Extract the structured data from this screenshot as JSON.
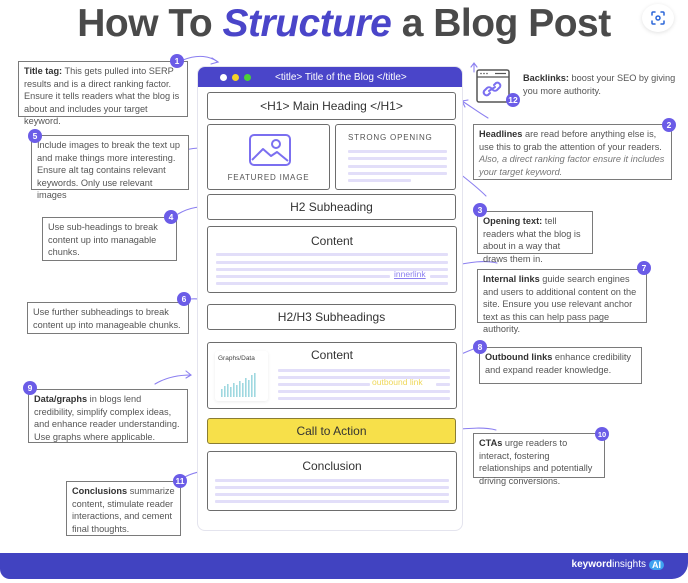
{
  "title": {
    "prefix": "How To ",
    "accent": "Structure",
    "suffix": " a Blog Post",
    "accent_color": "#4a45c9"
  },
  "lens_button": {
    "icon": "lens-scan-icon"
  },
  "browser": {
    "bar_title": "<title> Title of the Blog </title>",
    "bar_color": "#4a45c9",
    "dots": [
      "#ffffff",
      "#f5d327",
      "#4cd137"
    ],
    "h1": "<H1> Main Heading </H1>",
    "featured_image": "FEATURED IMAGE",
    "strong_opening": "STRONG OPENING",
    "h2": "H2 Subheading",
    "content_1": "Content",
    "innerlink": "innerlink",
    "h2h3": "H2/H3 Subheadings",
    "content_2": "Content",
    "graphs_label": "Graphs/Data",
    "outbound_link": "outbound link",
    "cta": "Call to Action",
    "cta_color": "#f7e04a",
    "conclusion": "Conclusion"
  },
  "callouts": {
    "c1": {
      "num": "1",
      "bold": "Title tag:",
      "text": " This gets pulled into SERP results and is a direct ranking factor. Ensure it tells  readers what the blog is about and includes your target keyword."
    },
    "c2": {
      "num": "2",
      "bold": "Headlines",
      "text": " are read before anything else is, use this to grab the attention of your readers.",
      "italic": "Also, a direct ranking factor ensure it includes your target keyword."
    },
    "c3": {
      "num": "3",
      "bold": "Opening text:",
      "text": " tell readers what the blog is about in a way that draws them in."
    },
    "c4": {
      "num": "4",
      "text": "Use sub-headings to break content up into managable chunks."
    },
    "c5": {
      "num": "5",
      "text": "Include images to break the text up and make things more interesting. Ensure alt tag contains relevant keywords.  Only use relevant images"
    },
    "c6": {
      "num": "6",
      "text": "Use further subheadings to break content up into manageable chunks."
    },
    "c7": {
      "num": "7",
      "bold": "Internal links",
      "text": " guide search engines and users to additional content on the site. Ensure you use relevant anchor text as this can help pass page authority."
    },
    "c8": {
      "num": "8",
      "bold": "Outbound links",
      "text": " enhance credibility and expand reader knowledge."
    },
    "c9": {
      "num": "9",
      "bold": "Data/graphs",
      "text": " in blogs lend credibility, simplify complex ideas, and enhance reader understanding. Use graphs where applicable."
    },
    "c10": {
      "num": "10",
      "bold": "CTAs",
      "text": " urge readers to interact, fostering  relationships and potentially driving conversions."
    },
    "c11": {
      "num": "11",
      "bold": "Conclusions",
      "text": " summarize content, stimulate reader interactions, and cement final thoughts."
    },
    "c12": {
      "num": "12",
      "bold": "Backlinks:",
      "text": " boost your SEO by giving you more authority."
    }
  },
  "footer": {
    "brand_bold": "keyword",
    "brand_light": "insights",
    "brand_badge": "AI",
    "color": "#4143c1"
  },
  "accent": "#6b5ce7"
}
